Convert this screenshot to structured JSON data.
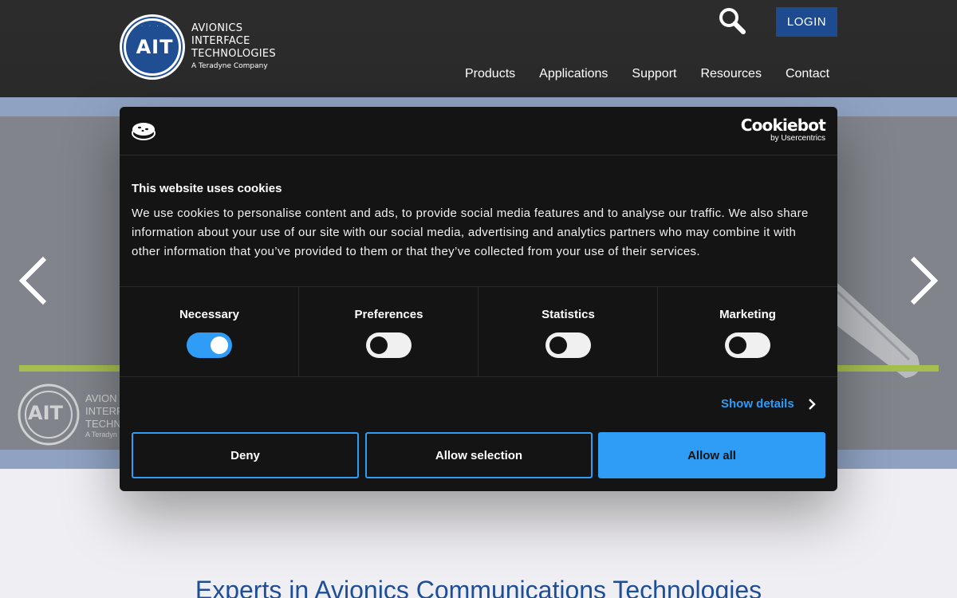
{
  "header": {
    "logo": {
      "mark": "AIT",
      "line1": "AVIONICS",
      "line2": "INTERFACE",
      "line3": "TECHNOLOGIES",
      "tagline": "A Teradyne Company"
    },
    "search_icon": "search-icon",
    "login_label": "LOGIN",
    "nav": [
      {
        "label": "Products"
      },
      {
        "label": "Applications"
      },
      {
        "label": "Support"
      },
      {
        "label": "Resources"
      },
      {
        "label": "Contact"
      }
    ]
  },
  "hero": {
    "prev_icon": "chevron-left-icon",
    "next_icon": "chevron-right-icon",
    "watermark": {
      "mark": "AIT",
      "line1": "AVION",
      "line2": "INTERF",
      "line3": "TECHN",
      "tagline": "A Teradyn"
    }
  },
  "main": {
    "headline": "Experts in Avionics Communications Technologies"
  },
  "cookie_dialog": {
    "brand": "Cookiebot",
    "brand_by": "by Usercentrics",
    "title": "This website uses cookies",
    "body": "We use cookies to personalise content and ads, to provide social media features and to analyse our traffic. We also share information about your use of our site with our social media, advertising and analytics partners who may combine it with other information that you’ve provided to them or that they’ve collected from your use of their services.",
    "categories": [
      {
        "label": "Necessary",
        "enabled": true
      },
      {
        "label": "Preferences",
        "enabled": false
      },
      {
        "label": "Statistics",
        "enabled": false
      },
      {
        "label": "Marketing",
        "enabled": false
      }
    ],
    "show_details": "Show details",
    "buttons": {
      "deny": "Deny",
      "allow_selection": "Allow selection",
      "allow_all": "Allow all"
    },
    "colors": {
      "background": "#141414",
      "accent": "#2f9cf5"
    }
  }
}
